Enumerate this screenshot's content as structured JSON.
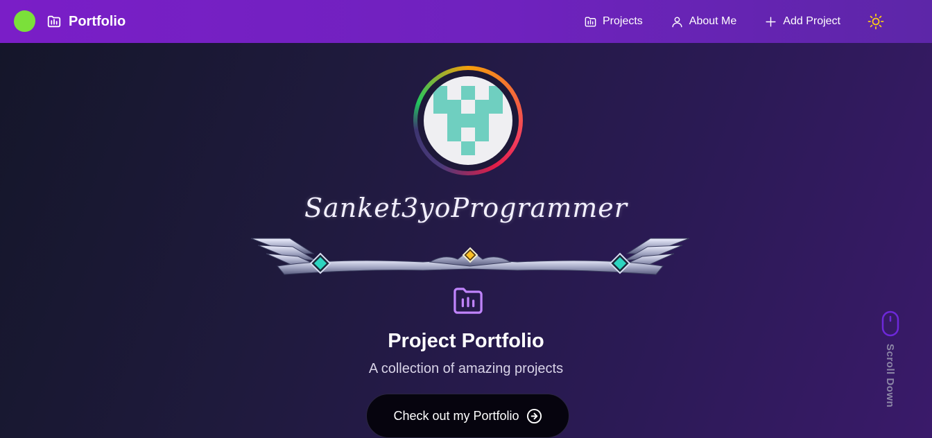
{
  "navbar": {
    "brand_label": "Portfolio",
    "links": [
      {
        "label": "Projects",
        "icon": "folder-chart-icon"
      },
      {
        "label": "About Me",
        "icon": "user-icon"
      },
      {
        "label": "Add Project",
        "icon": "plus-icon"
      }
    ],
    "theme_icon": "sun-icon"
  },
  "hero": {
    "signature": "Sanket3yoProgrammer",
    "title": "Project Portfolio",
    "subtitle": "A collection of amazing projects",
    "cta_label": "Check out my Portfolio"
  },
  "scroll_hint": "Scroll Down",
  "colors": {
    "navbar": "#7a1ec7",
    "logo_blob": "#7be03a",
    "accent_purple": "#c084fc",
    "avatar_teal": "#6fcfc0",
    "cta_bg": "#06040e",
    "sun": "#facc15"
  }
}
